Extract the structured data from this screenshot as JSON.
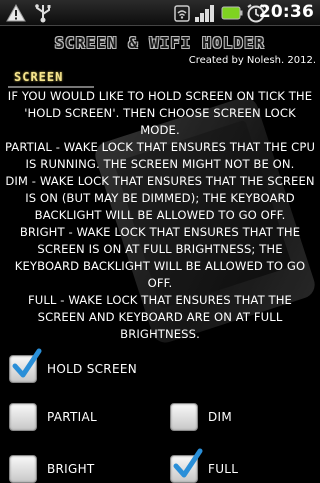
{
  "status_bar": {
    "time": "20:36",
    "icons": [
      "warning-icon",
      "usb-icon",
      "wifi-icon",
      "signal-bars-icon",
      "battery-icon",
      "alarm-icon"
    ]
  },
  "header": {
    "title": "Screen & Wifi Holder",
    "credit": "Created by Nolesh. 2012."
  },
  "section": {
    "title": "SCREEN",
    "description": [
      "IF YOU WOULD LIKE TO HOLD SCREEN ON TICK THE 'HOLD SCREEN'. THEN CHOOSE SCREEN LOCK MODE.",
      "PARTIAL - WAKE LOCK THAT ENSURES THAT THE CPU IS RUNNING. THE SCREEN MIGHT NOT BE ON.",
      "DIM - WAKE LOCK THAT ENSURES THAT THE SCREEN IS ON (BUT MAY BE DIMMED); THE KEYBOARD BACKLIGHT WILL BE ALLOWED TO GO OFF.",
      "BRIGHT - WAKE LOCK THAT ENSURES THAT THE SCREEN IS ON AT FULL BRIGHTNESS; THE KEYBOARD BACKLIGHT WILL BE ALLOWED TO GO OFF.",
      "FULL - WAKE LOCK THAT ENSURES THAT THE SCREEN AND KEYBOARD ARE ON AT FULL BRIGHTNESS."
    ]
  },
  "options": {
    "hold_screen": {
      "label": "HOLD SCREEN",
      "checked": true
    },
    "partial": {
      "label": "PARTIAL",
      "checked": false
    },
    "dim": {
      "label": "DIM",
      "checked": false
    },
    "bright": {
      "label": "BRIGHT",
      "checked": false
    },
    "full": {
      "label": "FULL",
      "checked": true
    }
  },
  "colors": {
    "section_title": "#f6e58d",
    "check": "#2a8fd8"
  }
}
